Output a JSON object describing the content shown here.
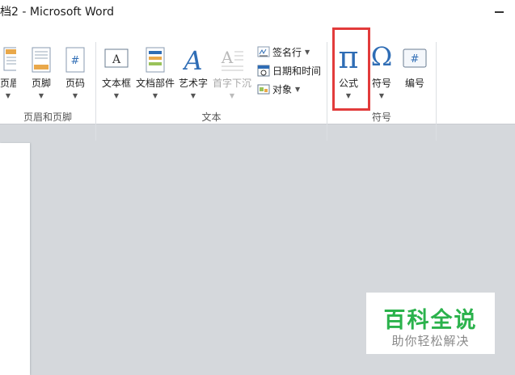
{
  "window": {
    "title": "档2 - Microsoft Word"
  },
  "ribbon": {
    "buttons": [
      {
        "label": "页眉",
        "icon": "header-icon"
      },
      {
        "label": "页脚",
        "icon": "footer-icon"
      },
      {
        "label": "页码",
        "icon": "page-number-icon"
      },
      {
        "label": "文本框",
        "icon": "textbox-icon"
      },
      {
        "label": "文档部件",
        "icon": "quick-parts-icon"
      },
      {
        "label": "艺术字",
        "icon": "wordart-icon"
      },
      {
        "label": "首字下沉",
        "icon": "drop-cap-icon",
        "disabled": true
      },
      {
        "label": "公式",
        "icon": "pi-icon"
      },
      {
        "label": "符号",
        "icon": "omega-icon"
      },
      {
        "label": "编号",
        "icon": "number-icon"
      }
    ],
    "small_buttons": [
      {
        "label": "签名行",
        "icon": "signature-icon",
        "dropdown": true
      },
      {
        "label": "日期和时间",
        "icon": "calendar-icon",
        "dropdown": false
      },
      {
        "label": "对象",
        "icon": "object-icon",
        "dropdown": true
      }
    ],
    "groups": [
      {
        "label": "页眉和页脚"
      },
      {
        "label": "文本"
      },
      {
        "label": "符号"
      }
    ],
    "symbols": {
      "pi": "π",
      "omega": "Ω",
      "hash": "#"
    }
  },
  "watermark": {
    "title": "百科全说",
    "subtitle": "助你轻松解决"
  },
  "colors": {
    "highlight": "#e23b3b",
    "watermark_green": "#2bb24c",
    "ribbon_icon_blue": "#2f6db5",
    "workspace": "#d5d8dc"
  }
}
